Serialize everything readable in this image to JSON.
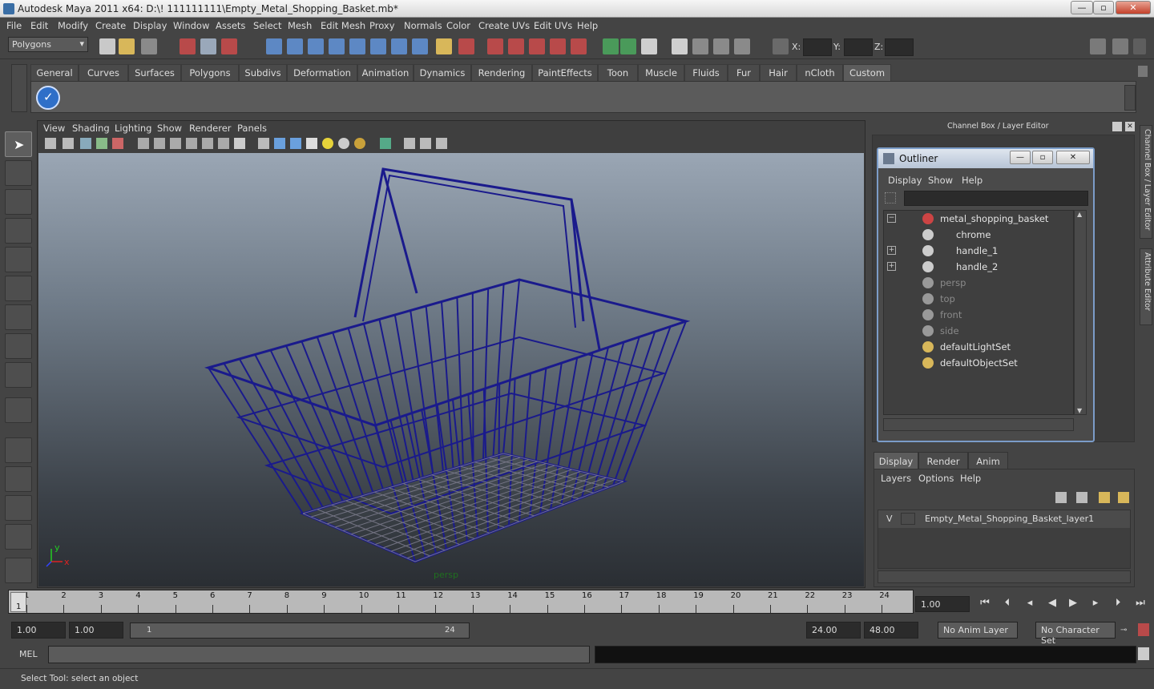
{
  "window": {
    "title": "Autodesk Maya 2011 x64: D:\\! 111111111\\Empty_Metal_Shopping_Basket.mb*",
    "minimize": "—",
    "maximize": "▫",
    "close": "✕"
  },
  "menubar": [
    "File",
    "Edit",
    "Modify",
    "Create",
    "Display",
    "Window",
    "Assets",
    "Select",
    "Mesh",
    "Edit Mesh",
    "Proxy",
    "Normals",
    "Color",
    "Create UVs",
    "Edit UVs",
    "Help"
  ],
  "statusline": {
    "mode": "Polygons",
    "x_label": "X:",
    "y_label": "Y:",
    "z_label": "Z:"
  },
  "shelf_tabs": [
    "General",
    "Curves",
    "Surfaces",
    "Polygons",
    "Subdivs",
    "Deformation",
    "Animation",
    "Dynamics",
    "Rendering",
    "PaintEffects",
    "Toon",
    "Muscle",
    "Fluids",
    "Fur",
    "Hair",
    "nCloth",
    "Custom"
  ],
  "shelf_active": "Custom",
  "viewport": {
    "menu": [
      "View",
      "Shading",
      "Lighting",
      "Show",
      "Renderer",
      "Panels"
    ],
    "camera_label": "persp",
    "axis_x": "x",
    "axis_y": "y",
    "wire_color": "#1a1a8c"
  },
  "channel_box": {
    "header": "Channel Box / Layer Editor"
  },
  "side_tabs": [
    "Channel Box / Layer Editor",
    "Attribute Editor"
  ],
  "outliner": {
    "title": "Outliner",
    "menu": [
      "Display",
      "Show",
      "Help"
    ],
    "items": [
      {
        "label": "metal_shopping_basket",
        "icon": "transform-icon",
        "expand": "−",
        "indent": 0,
        "dim": false
      },
      {
        "label": "chrome",
        "icon": "mesh-icon",
        "expand": "",
        "indent": 1,
        "dim": false
      },
      {
        "label": "handle_1",
        "icon": "mesh-icon",
        "expand": "+",
        "indent": 1,
        "dim": false
      },
      {
        "label": "handle_2",
        "icon": "mesh-icon",
        "expand": "+",
        "indent": 1,
        "dim": false
      },
      {
        "label": "persp",
        "icon": "camera-icon",
        "expand": "",
        "indent": 0,
        "dim": true
      },
      {
        "label": "top",
        "icon": "camera-icon",
        "expand": "",
        "indent": 0,
        "dim": true
      },
      {
        "label": "front",
        "icon": "camera-icon",
        "expand": "",
        "indent": 0,
        "dim": true
      },
      {
        "label": "side",
        "icon": "camera-icon",
        "expand": "",
        "indent": 0,
        "dim": true
      },
      {
        "label": "defaultLightSet",
        "icon": "set-icon",
        "expand": "",
        "indent": 0,
        "dim": false
      },
      {
        "label": "defaultObjectSet",
        "icon": "set-icon",
        "expand": "",
        "indent": 0,
        "dim": false
      }
    ]
  },
  "layer_editor": {
    "tabs": [
      "Display",
      "Render",
      "Anim"
    ],
    "active": "Display",
    "menu": [
      "Layers",
      "Options",
      "Help"
    ],
    "layers": [
      {
        "visible": "V",
        "name": "Empty_Metal_Shopping_Basket_layer1"
      }
    ]
  },
  "timeline": {
    "ticks": [
      "1",
      "2",
      "3",
      "4",
      "5",
      "6",
      "7",
      "8",
      "9",
      "10",
      "11",
      "12",
      "13",
      "14",
      "15",
      "16",
      "17",
      "18",
      "19",
      "20",
      "21",
      "22",
      "23",
      "24"
    ],
    "current": "1",
    "current_field": "1.00"
  },
  "range": {
    "start": "1.00",
    "start2": "1.00",
    "slider_left": "1",
    "slider_right": "24",
    "end": "24.00",
    "end2": "48.00",
    "anim_layer": "No Anim Layer",
    "char_set": "No Character Set"
  },
  "cmdline": {
    "label": "MEL"
  },
  "status": {
    "text": "Select Tool: select an object"
  }
}
